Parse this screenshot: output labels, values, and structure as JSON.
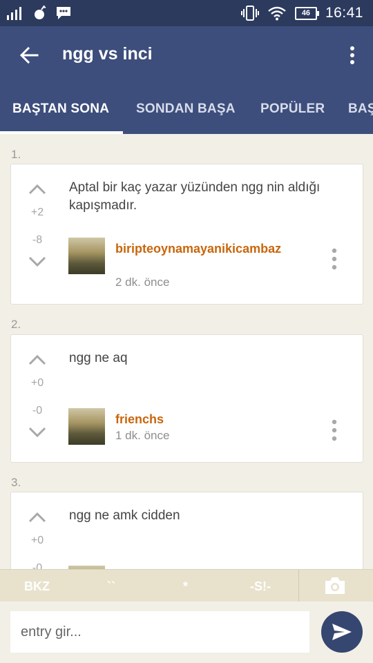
{
  "status_bar": {
    "time": "16:41",
    "battery": "46",
    "icons": [
      "signal-icon",
      "bomb-icon",
      "chat-icon",
      "vibrate-icon",
      "wifi-icon",
      "battery-icon"
    ]
  },
  "app_bar": {
    "title": "ngg vs inci",
    "back_icon": "arrow-left-icon",
    "menu_icon": "more-vert-icon"
  },
  "tabs": [
    {
      "label": "BAŞTAN SONA",
      "active": true
    },
    {
      "label": "SONDAN BAŞA",
      "active": false
    },
    {
      "label": "POPÜLER",
      "active": false
    },
    {
      "label": "BAŞ",
      "active": false
    }
  ],
  "entries": [
    {
      "number": "1.",
      "text": "Aptal bir kaç yazar yüzünden ngg nin aldığı kapışmadır.",
      "upvotes": "+2",
      "downvotes": "-8",
      "author": "biripteoynamayanikicambaz",
      "time": "2 dk. önce"
    },
    {
      "number": "2.",
      "text": "ngg ne aq",
      "upvotes": "+0",
      "downvotes": "-0",
      "author": "frienchs",
      "time": "1 dk. önce"
    },
    {
      "number": "3.",
      "text": "ngg ne amk cidden",
      "upvotes": "+0",
      "downvotes": "-0"
    }
  ],
  "toolbar": {
    "bkz": "BKZ",
    "backtick": "``",
    "star": "*",
    "spoiler": "-S!-",
    "camera_icon": "camera-icon"
  },
  "composer": {
    "placeholder": "entry gir...",
    "send_icon": "send-icon"
  },
  "colors": {
    "status_bar": "#2c3a5e",
    "app_bar": "#3d4e7c",
    "author": "#c8660c",
    "background": "#f2efe6",
    "toolbar": "#e8e2cd",
    "send_button": "#354770"
  }
}
